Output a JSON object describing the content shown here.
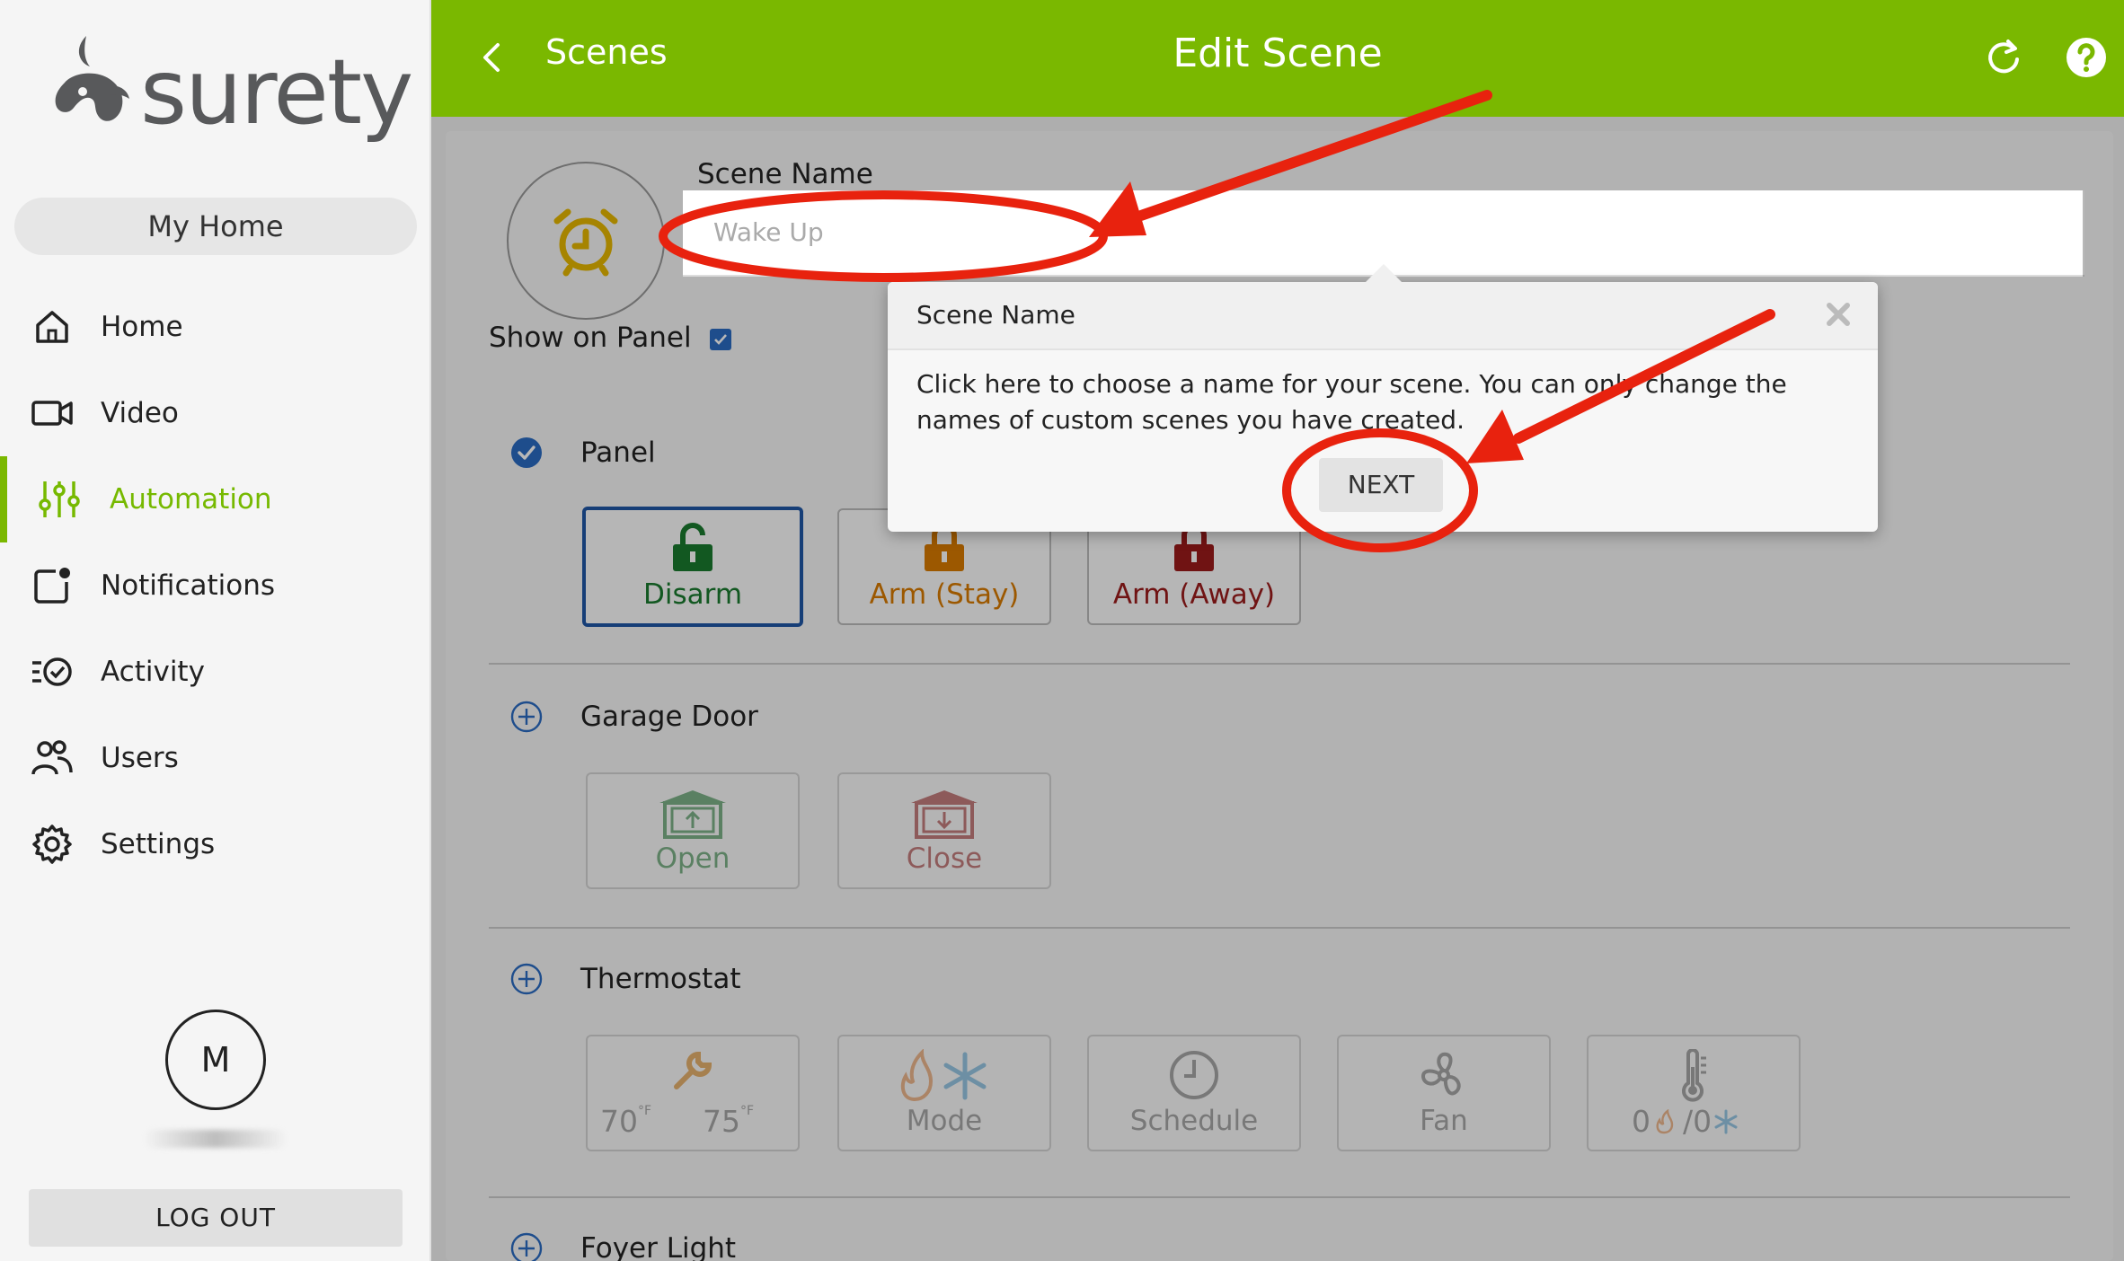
{
  "sidebar": {
    "brand": "surety",
    "my_home_label": "My Home",
    "items": [
      {
        "label": "Home",
        "icon": "home-icon"
      },
      {
        "label": "Video",
        "icon": "video-camera-icon"
      },
      {
        "label": "Automation",
        "icon": "sliders-icon",
        "active": true
      },
      {
        "label": "Notifications",
        "icon": "notification-icon"
      },
      {
        "label": "Activity",
        "icon": "activity-list-icon"
      },
      {
        "label": "Users",
        "icon": "users-icon"
      },
      {
        "label": "Settings",
        "icon": "gear-icon"
      }
    ],
    "user_initial": "M",
    "logout_label": "LOG OUT"
  },
  "header": {
    "back_label": "Scenes",
    "title": "Edit Scene",
    "icons": [
      "chevron-left-icon",
      "refresh-icon",
      "help-icon"
    ],
    "background_color": "#7ab800"
  },
  "scene": {
    "icon": "alarm-clock-icon",
    "name_label": "Scene Name",
    "name_placeholder": "Wake Up",
    "show_on_panel_label": "Show on Panel",
    "show_on_panel_checked": true
  },
  "sections": {
    "panel": {
      "label": "Panel",
      "enabled": true,
      "actions": [
        {
          "label": "Disarm",
          "color": "#1a7a2e",
          "selected": true
        },
        {
          "label": "Arm (Stay)",
          "color": "#d97a00"
        },
        {
          "label": "Arm (Away)",
          "color": "#9b1b1b"
        }
      ]
    },
    "garage": {
      "label": "Garage Door",
      "actions": [
        {
          "label": "Open",
          "color": "#1a7a2e"
        },
        {
          "label": "Close",
          "color": "#9b1b1b"
        }
      ]
    },
    "thermostat": {
      "label": "Thermostat",
      "heat_setpoint": "70",
      "cool_setpoint": "75",
      "unit": "°F",
      "mode_label": "Mode",
      "schedule_label": "Schedule",
      "fan_label": "Fan",
      "offset_heat": "0",
      "offset_cool": "/0"
    },
    "foyer": {
      "label": "Foyer Light"
    }
  },
  "popover": {
    "title": "Scene Name",
    "body": "Click here to choose a name for your scene. You can only change the names of custom scenes you have created.",
    "next_label": "NEXT"
  },
  "colors": {
    "accent": "#7ab800",
    "annotation": "#e8220e",
    "checkbox": "#2a6bc2"
  }
}
